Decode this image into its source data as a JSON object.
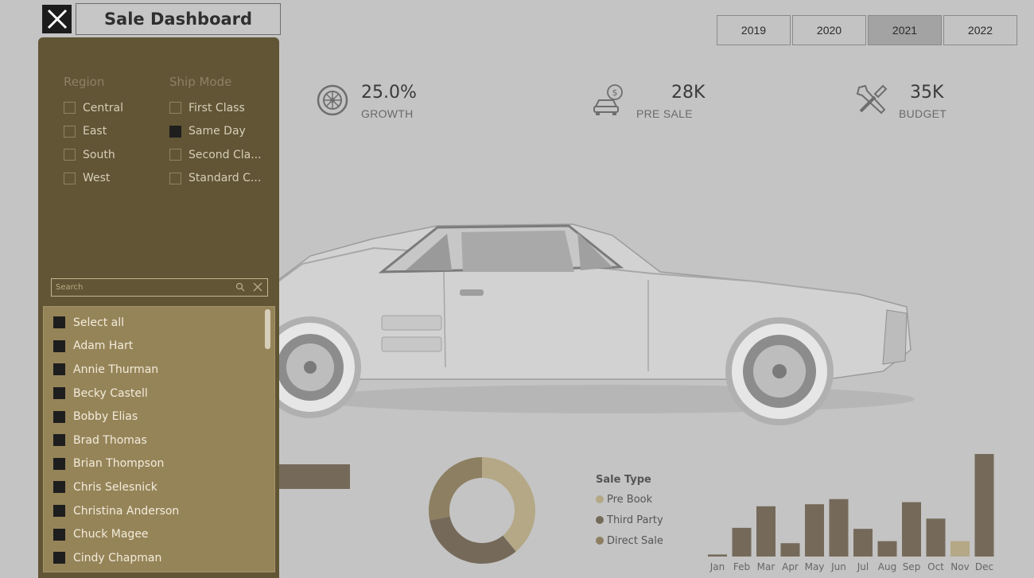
{
  "header": {
    "title": "Sale Dashboard",
    "close_icon": "close-icon"
  },
  "years": {
    "items": [
      "2019",
      "2020",
      "2021",
      "2022"
    ],
    "selected": "2021"
  },
  "kpis": [
    {
      "value": "25.0%",
      "label": "GROWTH",
      "icon": "tire-icon"
    },
    {
      "value": "28K",
      "label": "PRE SALE",
      "icon": "car-dollar-icon"
    },
    {
      "value": "35K",
      "label": "BUDGET",
      "icon": "tools-icon"
    }
  ],
  "filters": {
    "region": {
      "heading": "Region",
      "items": [
        {
          "label": "Central",
          "checked": false
        },
        {
          "label": "East",
          "checked": false
        },
        {
          "label": "South",
          "checked": false
        },
        {
          "label": "West",
          "checked": false
        }
      ]
    },
    "ship_mode": {
      "heading": "Ship Mode",
      "items": [
        {
          "label": "First Class",
          "checked": false
        },
        {
          "label": "Same Day",
          "checked": true
        },
        {
          "label": "Second Cla...",
          "checked": false
        },
        {
          "label": "Standard C...",
          "checked": false
        }
      ]
    }
  },
  "search": {
    "placeholder": "Search"
  },
  "customers": {
    "items": [
      "Select all",
      "Adam Hart",
      "Annie Thurman",
      "Becky Castell",
      "Bobby Elias",
      "Brad Thomas",
      "Brian Thompson",
      "Chris Selesnick",
      "Christina Anderson",
      "Chuck Magee",
      "Cindy Chapman"
    ]
  },
  "colors": {
    "panel": "#615535",
    "list_bg": "#968459",
    "accent_light": "#b4a886",
    "accent_dark": "#756a5a",
    "accent_mid": "#8d7f61"
  },
  "chart_data": [
    {
      "type": "pie",
      "title": "Sale Type",
      "donut": true,
      "series": [
        {
          "name": "Pre Book",
          "value": 39,
          "color": "#b4a886"
        },
        {
          "name": "Third Party",
          "value": 33,
          "color": "#756a5a"
        },
        {
          "name": "Direct Sale",
          "value": 28,
          "color": "#8d7f61"
        }
      ]
    },
    {
      "type": "bar",
      "categories": [
        "Jan",
        "Feb",
        "Mar",
        "Apr",
        "May",
        "Jun",
        "Jul",
        "Aug",
        "Sep",
        "Oct",
        "Nov",
        "Dec"
      ],
      "values": [
        2,
        28,
        49,
        13,
        51,
        56,
        27,
        15,
        53,
        37,
        15,
        100
      ],
      "highlight": "Nov",
      "ylim": [
        0,
        100
      ]
    }
  ]
}
